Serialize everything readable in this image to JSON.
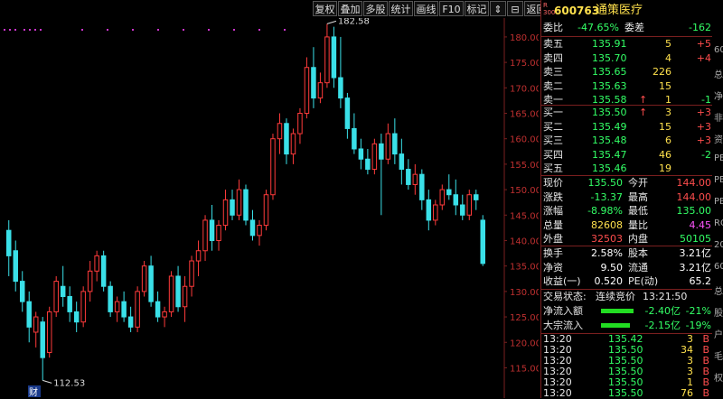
{
  "toolbar": {
    "buttons": [
      "复权",
      "叠加",
      "多股",
      "统计",
      "画线",
      "F10",
      "标记",
      "⇕",
      "⊟",
      "返回"
    ]
  },
  "chart_data": {
    "type": "candlestick",
    "y_ticks": [
      115,
      120,
      125,
      130,
      135,
      140,
      145,
      150,
      155,
      160,
      165,
      170,
      175,
      180
    ],
    "ylim": [
      111,
      183
    ],
    "high_label": "182.58",
    "low_label": "112.53",
    "marker_label": "财",
    "candles": [
      {
        "o": 142,
        "h": 144,
        "l": 133,
        "c": 137
      },
      {
        "o": 138,
        "h": 140,
        "l": 130,
        "c": 132
      },
      {
        "o": 132,
        "h": 134,
        "l": 126,
        "c": 128
      },
      {
        "o": 128,
        "h": 130,
        "l": 120,
        "c": 123
      },
      {
        "o": 122,
        "h": 126,
        "l": 119,
        "c": 125
      },
      {
        "o": 124,
        "h": 125,
        "l": 112.53,
        "c": 117
      },
      {
        "o": 118,
        "h": 127,
        "l": 117,
        "c": 126
      },
      {
        "o": 126,
        "h": 133,
        "l": 125,
        "c": 132
      },
      {
        "o": 131,
        "h": 135,
        "l": 127,
        "c": 129
      },
      {
        "o": 129,
        "h": 131,
        "l": 124,
        "c": 126
      },
      {
        "o": 126,
        "h": 128,
        "l": 122,
        "c": 124
      },
      {
        "o": 124,
        "h": 131,
        "l": 123,
        "c": 130
      },
      {
        "o": 130,
        "h": 136,
        "l": 128,
        "c": 134
      },
      {
        "o": 134,
        "h": 138,
        "l": 132,
        "c": 137
      },
      {
        "o": 137,
        "h": 138,
        "l": 130,
        "c": 131
      },
      {
        "o": 131,
        "h": 132,
        "l": 125,
        "c": 126
      },
      {
        "o": 126,
        "h": 129,
        "l": 124,
        "c": 128
      },
      {
        "o": 128,
        "h": 130,
        "l": 124,
        "c": 125
      },
      {
        "o": 125,
        "h": 127,
        "l": 122,
        "c": 123
      },
      {
        "o": 123,
        "h": 131,
        "l": 122,
        "c": 130
      },
      {
        "o": 130,
        "h": 136,
        "l": 129,
        "c": 135
      },
      {
        "o": 135,
        "h": 137,
        "l": 127,
        "c": 128
      },
      {
        "o": 128,
        "h": 130,
        "l": 124,
        "c": 125
      },
      {
        "o": 125,
        "h": 127,
        "l": 123,
        "c": 126
      },
      {
        "o": 126,
        "h": 134,
        "l": 125,
        "c": 133
      },
      {
        "o": 133,
        "h": 135,
        "l": 126,
        "c": 127
      },
      {
        "o": 127,
        "h": 133,
        "l": 124,
        "c": 131
      },
      {
        "o": 131,
        "h": 137,
        "l": 129,
        "c": 136
      },
      {
        "o": 136,
        "h": 140,
        "l": 133,
        "c": 138
      },
      {
        "o": 138,
        "h": 145,
        "l": 136,
        "c": 144
      },
      {
        "o": 144,
        "h": 147,
        "l": 138,
        "c": 140
      },
      {
        "o": 140,
        "h": 144,
        "l": 138,
        "c": 143
      },
      {
        "o": 143,
        "h": 150,
        "l": 142,
        "c": 148
      },
      {
        "o": 148,
        "h": 150,
        "l": 144,
        "c": 145
      },
      {
        "o": 145,
        "h": 152,
        "l": 144,
        "c": 150
      },
      {
        "o": 150,
        "h": 151,
        "l": 143,
        "c": 144
      },
      {
        "o": 144,
        "h": 146,
        "l": 140,
        "c": 141
      },
      {
        "o": 141,
        "h": 144,
        "l": 139,
        "c": 143
      },
      {
        "o": 143,
        "h": 150,
        "l": 142,
        "c": 149
      },
      {
        "o": 149,
        "h": 161,
        "l": 148,
        "c": 160
      },
      {
        "o": 160,
        "h": 165,
        "l": 157,
        "c": 163
      },
      {
        "o": 163,
        "h": 164,
        "l": 155,
        "c": 157
      },
      {
        "o": 157,
        "h": 162,
        "l": 155,
        "c": 161
      },
      {
        "o": 161,
        "h": 166,
        "l": 159,
        "c": 165
      },
      {
        "o": 165,
        "h": 176,
        "l": 164,
        "c": 174
      },
      {
        "o": 174,
        "h": 178,
        "l": 166,
        "c": 168
      },
      {
        "o": 168,
        "h": 173,
        "l": 167,
        "c": 171
      },
      {
        "o": 171,
        "h": 182.58,
        "l": 170,
        "c": 180
      },
      {
        "o": 180,
        "h": 182,
        "l": 170,
        "c": 172
      },
      {
        "o": 172,
        "h": 180,
        "l": 166,
        "c": 168
      },
      {
        "o": 168,
        "h": 169,
        "l": 160,
        "c": 162
      },
      {
        "o": 162,
        "h": 165,
        "l": 157,
        "c": 158
      },
      {
        "o": 158,
        "h": 160,
        "l": 154,
        "c": 156
      },
      {
        "o": 156,
        "h": 158,
        "l": 153,
        "c": 154
      },
      {
        "o": 154,
        "h": 160,
        "l": 153,
        "c": 159
      },
      {
        "o": 159,
        "h": 161,
        "l": 145,
        "c": 156
      },
      {
        "o": 156,
        "h": 163,
        "l": 155,
        "c": 161
      },
      {
        "o": 161,
        "h": 164,
        "l": 155,
        "c": 157
      },
      {
        "o": 157,
        "h": 160,
        "l": 151,
        "c": 154
      },
      {
        "o": 154,
        "h": 156,
        "l": 150,
        "c": 151
      },
      {
        "o": 151,
        "h": 155,
        "l": 149,
        "c": 153
      },
      {
        "o": 153,
        "h": 154,
        "l": 146,
        "c": 148
      },
      {
        "o": 148,
        "h": 150,
        "l": 142,
        "c": 144
      },
      {
        "o": 144,
        "h": 148,
        "l": 143,
        "c": 147
      },
      {
        "o": 147,
        "h": 151,
        "l": 146,
        "c": 150
      },
      {
        "o": 150,
        "h": 153,
        "l": 148,
        "c": 149
      },
      {
        "o": 149,
        "h": 152,
        "l": 145,
        "c": 147
      },
      {
        "o": 147,
        "h": 149,
        "l": 144,
        "c": 145
      },
      {
        "o": 145,
        "h": 150,
        "l": 144,
        "c": 149
      },
      {
        "o": 149,
        "h": 150,
        "l": 146,
        "c": 148
      },
      {
        "o": 144,
        "h": 145,
        "l": 135,
        "c": 135.5
      }
    ]
  },
  "quote": {
    "code": "600763",
    "name": "通策医疗",
    "ratio_label": "委比",
    "ratio_value": "-47.65%",
    "diff_label": "委差",
    "diff_value": "-162",
    "asks": [
      {
        "label": "卖五",
        "price": "135.91",
        "vol": "5",
        "chg": "+5"
      },
      {
        "label": "卖四",
        "price": "135.70",
        "vol": "4",
        "chg": "+4"
      },
      {
        "label": "卖三",
        "price": "135.65",
        "vol": "226",
        "chg": ""
      },
      {
        "label": "卖二",
        "price": "135.63",
        "vol": "15",
        "chg": ""
      },
      {
        "label": "卖一",
        "price": "135.58",
        "vol": "1",
        "chg": "-1",
        "arrow": "↑"
      }
    ],
    "bids": [
      {
        "label": "买一",
        "price": "135.50",
        "vol": "3",
        "chg": "+3",
        "arrow": "↑"
      },
      {
        "label": "买二",
        "price": "135.49",
        "vol": "15",
        "chg": "+3"
      },
      {
        "label": "买三",
        "price": "135.48",
        "vol": "6",
        "chg": "+3"
      },
      {
        "label": "买四",
        "price": "135.47",
        "vol": "46",
        "chg": "-2"
      },
      {
        "label": "买五",
        "price": "135.46",
        "vol": "19",
        "chg": ""
      }
    ],
    "stats": [
      {
        "l1": "现价",
        "v1": "135.50",
        "l2": "今开",
        "v2": "144.00",
        "c1": "grn",
        "c2": "red"
      },
      {
        "l1": "涨跌",
        "v1": "-13.37",
        "l2": "最高",
        "v2": "144.00",
        "c1": "grn",
        "c2": "red"
      },
      {
        "l1": "涨幅",
        "v1": "-8.98%",
        "l2": "最低",
        "v2": "135.00",
        "c1": "grn",
        "c2": "grn"
      },
      {
        "l1": "总量",
        "v1": "82608",
        "l2": "量比",
        "v2": "4.45",
        "c1": "yel",
        "c2": "mag"
      },
      {
        "l1": "外盘",
        "v1": "32503",
        "l2": "内盘",
        "v2": "50105",
        "c1": "red",
        "c2": "grn"
      }
    ],
    "stats2": [
      {
        "l1": "换手",
        "v1": "2.58%",
        "l2": "股本",
        "v2": "3.21亿"
      },
      {
        "l1": "净资",
        "v1": "9.50",
        "l2": "流通",
        "v2": "3.21亿"
      },
      {
        "l1": "收益(一)",
        "v1": "0.520",
        "l2": "PE(动)",
        "v2": "65.2"
      }
    ],
    "status_label": "交易状态:",
    "status_value": "连续竞价",
    "status_time": "13:21:50",
    "flows": [
      {
        "label": "净流入额",
        "value": "-2.40亿",
        "pct": "-21%",
        "fill": 0.21
      },
      {
        "label": "大宗流入",
        "value": "-2.15亿",
        "pct": "-19%",
        "fill": 0.19
      }
    ],
    "ticks": [
      {
        "time": "13:20",
        "price": "135.42",
        "vol": "3",
        "dir": "B"
      },
      {
        "time": "13:20",
        "price": "135.50",
        "vol": "34",
        "dir": "B"
      },
      {
        "time": "13:20",
        "price": "135.50",
        "vol": "3",
        "dir": "B"
      },
      {
        "time": "13:20",
        "price": "135.50",
        "vol": "3",
        "dir": "B"
      },
      {
        "time": "13:20",
        "price": "135.50",
        "vol": "1",
        "dir": "B"
      },
      {
        "time": "13:20",
        "price": "135.50",
        "vol": "76",
        "dir": "B"
      }
    ]
  },
  "right_strip": [
    "60",
    "总",
    "净",
    "非",
    "资",
    "PE",
    "PE",
    "PB",
    "RO",
    "20",
    "60",
    "总",
    "股",
    "户",
    "毛",
    "权"
  ],
  "colors": {
    "up": "#ff3b3b",
    "down": "#3ae0e8",
    "panel_border": "#7a1f1f"
  }
}
